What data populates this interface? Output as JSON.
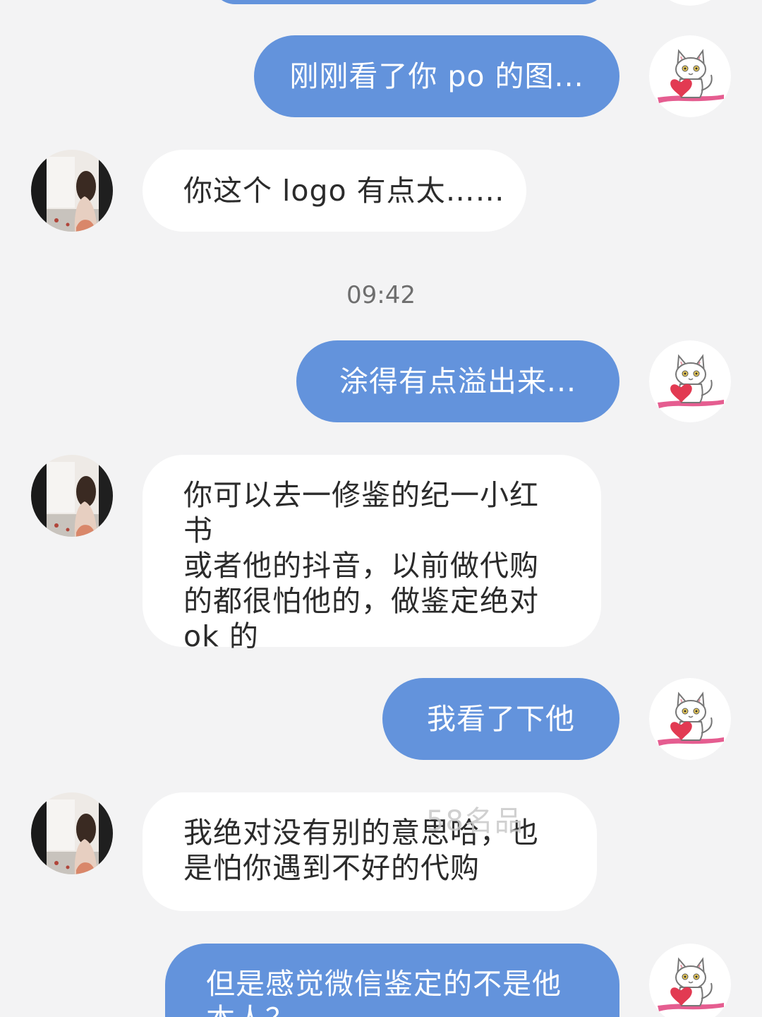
{
  "messages": [
    {
      "id": "m1",
      "direction": "out",
      "text": "刚刚看了你 po 的图..."
    },
    {
      "id": "m2",
      "direction": "in",
      "text": "你这个 logo 有点太……"
    },
    {
      "id": "m3",
      "direction": "out",
      "text": "涂得有点溢出来..."
    },
    {
      "id": "m4",
      "direction": "in",
      "lines": [
        "你可以去一修鉴的纪一小红书",
        "或者他的抖音，以前做代购",
        "的都很怕他的，做鉴定绝对",
        "ok 的"
      ]
    },
    {
      "id": "m5",
      "direction": "out",
      "text": "我看了下他"
    },
    {
      "id": "m6",
      "direction": "in",
      "lines": [
        "我绝对没有别的意思哈，也",
        "是怕你遇到不好的代购"
      ]
    },
    {
      "id": "m7",
      "direction": "out",
      "lines": [
        "但是感觉微信鉴定的不是他",
        "本人？"
      ]
    }
  ],
  "timestamp": "09:42",
  "watermark": "58名品",
  "avatars": {
    "self": "cat-holding-heart-avatar",
    "other": "woman-photo-avatar"
  },
  "colors": {
    "background": "#f3f3f4",
    "out_bubble": "#6393dc",
    "in_bubble": "#ffffff",
    "out_text": "#ffffff",
    "in_text": "#2b2b2b",
    "timestamp": "#6e6e6e"
  }
}
